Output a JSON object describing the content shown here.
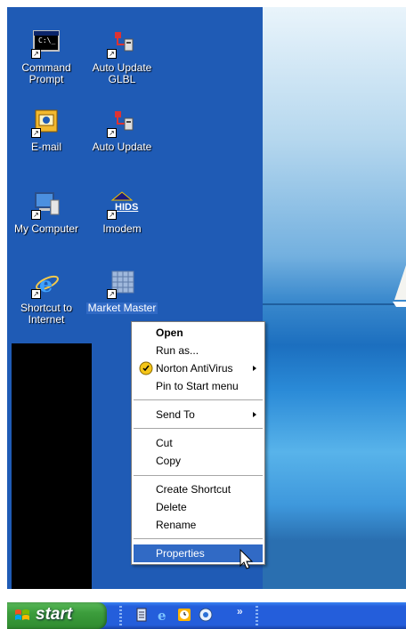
{
  "desktop": {
    "icons": [
      {
        "label_line1": "Command",
        "label_line2": "Prompt",
        "icon": "command-prompt-icon"
      },
      {
        "label_line1": "Auto Update",
        "label_line2": "GLBL",
        "icon": "network-shortcut-icon"
      },
      {
        "label_line1": "E-mail",
        "label_line2": "",
        "icon": "outlook-email-icon"
      },
      {
        "label_line1": "Auto Update",
        "label_line2": "",
        "icon": "network-shortcut-icon"
      },
      {
        "label_line1": "My Computer",
        "label_line2": "",
        "icon": "my-computer-icon"
      },
      {
        "label_line1": "Imodem",
        "label_line2": "",
        "icon": "imodem-icon"
      },
      {
        "label_line1": "Shortcut to",
        "label_line2": "Internet",
        "icon": "internet-explorer-icon"
      },
      {
        "label_line1": "Market Master",
        "label_line2": "",
        "icon": "market-master-icon",
        "selected": true
      }
    ],
    "imodem_logo_text": "HIDS",
    "command_prompt_text": "C:\\_"
  },
  "context_menu": {
    "items": {
      "open": "Open",
      "run_as": "Run as...",
      "norton": "Norton AntiVirus",
      "pin": "Pin to Start menu",
      "send_to": "Send To",
      "cut": "Cut",
      "copy": "Copy",
      "create_shortcut": "Create Shortcut",
      "delete": "Delete",
      "rename": "Rename",
      "properties": "Properties"
    },
    "highlighted": "properties"
  },
  "taskbar": {
    "start_label": "start",
    "quick_launch": [
      "notepad-icon",
      "internet-explorer-icon",
      "clock-icon",
      "windows-update-icon"
    ],
    "overflow_label": "»"
  },
  "colors": {
    "desktop": "#1f5bb5",
    "highlight": "#316ac5",
    "taskbar": "#245edb",
    "start_button": "#3c9d3c"
  }
}
